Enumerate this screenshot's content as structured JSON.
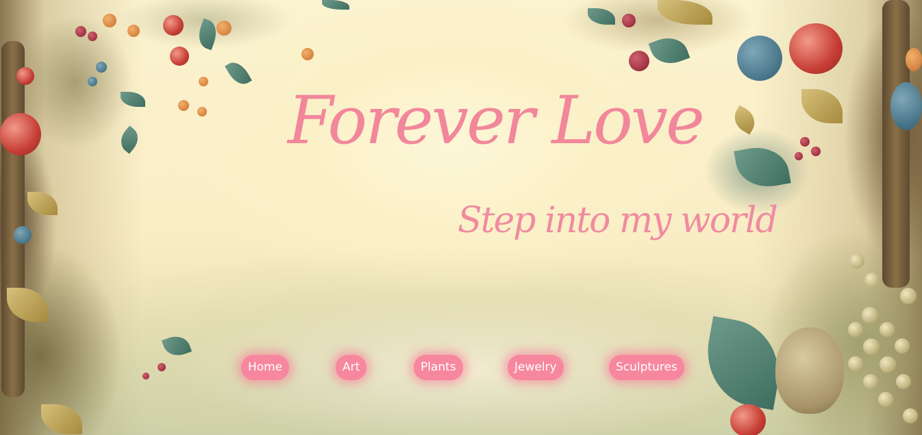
{
  "header": {
    "title": "Forever Love",
    "subtitle": "Step into my world"
  },
  "nav": {
    "items": [
      {
        "label": "Home"
      },
      {
        "label": "Art"
      },
      {
        "label": "Plants"
      },
      {
        "label": "Jewelry"
      },
      {
        "label": "Sculptures"
      }
    ]
  },
  "colors": {
    "accent_pink": "#f7879e",
    "title_pink": "#f2879b",
    "background_cream": "#fbf3cf"
  }
}
